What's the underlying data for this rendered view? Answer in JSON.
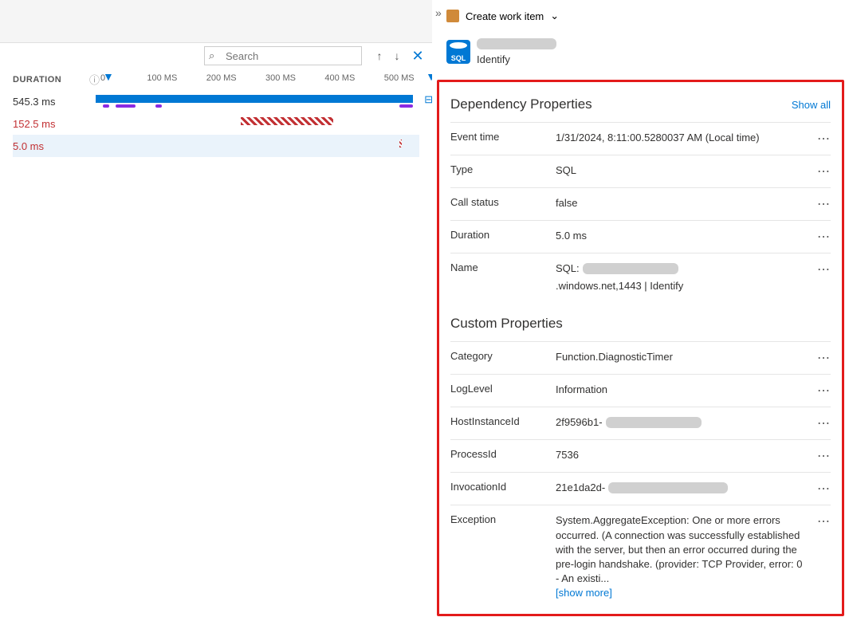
{
  "search": {
    "placeholder": "Search"
  },
  "axis": {
    "duration_label": "DURATION",
    "ticks": [
      "0",
      "100 MS",
      "200 MS",
      "300 MS",
      "400 MS",
      "500 MS"
    ]
  },
  "rows": [
    {
      "duration": "545.3 ms",
      "error": false
    },
    {
      "duration": "152.5 ms",
      "error": true
    },
    {
      "duration": "5.0 ms",
      "error": true
    }
  ],
  "right": {
    "create_work_item": "Create work item",
    "sql_badge": "SQL",
    "identify": "Identify"
  },
  "dep_section": {
    "title": "Dependency Properties",
    "show_all": "Show all"
  },
  "dep_props": {
    "event_time": {
      "key": "Event time",
      "value": "1/31/2024, 8:11:00.5280037 AM (Local time)"
    },
    "type": {
      "key": "Type",
      "value": "SQL"
    },
    "call_status": {
      "key": "Call status",
      "value": "false"
    },
    "duration": {
      "key": "Duration",
      "value": "5.0 ms"
    },
    "name": {
      "key": "Name",
      "prefix": "SQL:",
      "suffix": ".windows.net,1443 | Identify"
    }
  },
  "custom_section": {
    "title": "Custom Properties"
  },
  "custom_props": {
    "category": {
      "key": "Category",
      "value": "Function.DiagnosticTimer"
    },
    "loglevel": {
      "key": "LogLevel",
      "value": "Information"
    },
    "hostinstance": {
      "key": "HostInstanceId",
      "prefix": "2f9596b1-"
    },
    "processid": {
      "key": "ProcessId",
      "value": "7536"
    },
    "invocationid": {
      "key": "InvocationId",
      "prefix": "21e1da2d-"
    },
    "exception": {
      "key": "Exception",
      "value": "System.AggregateException: One or more errors occurred. (A connection was successfully established with the server, but then an error occurred during the pre-login handshake. (provider: TCP Provider, error: 0 - An existi...",
      "show_more": "[show more]"
    }
  }
}
